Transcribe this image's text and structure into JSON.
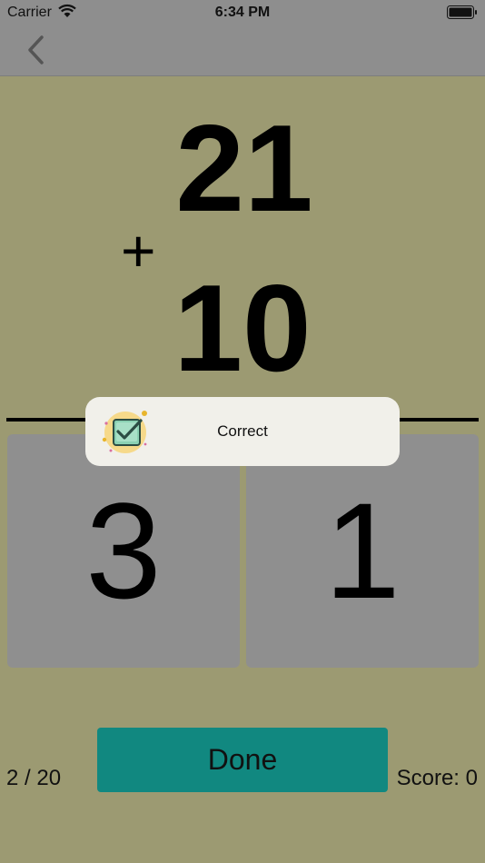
{
  "status_bar": {
    "carrier": "Carrier",
    "time": "6:34 PM"
  },
  "problem": {
    "top_number": "21",
    "operator": "+",
    "bottom_number": "10"
  },
  "answers": [
    "3",
    "1"
  ],
  "toast": {
    "text": "Correct",
    "icon": "checkbox-badge-icon"
  },
  "footer": {
    "progress": "2 / 20",
    "done_label": "Done",
    "score": "Score: 0"
  },
  "colors": {
    "background": "#9c9a72",
    "bars": "#8e8e8e",
    "cards": "#8f8f8f",
    "done_button": "#118880",
    "toast": "#f1f0ea"
  }
}
